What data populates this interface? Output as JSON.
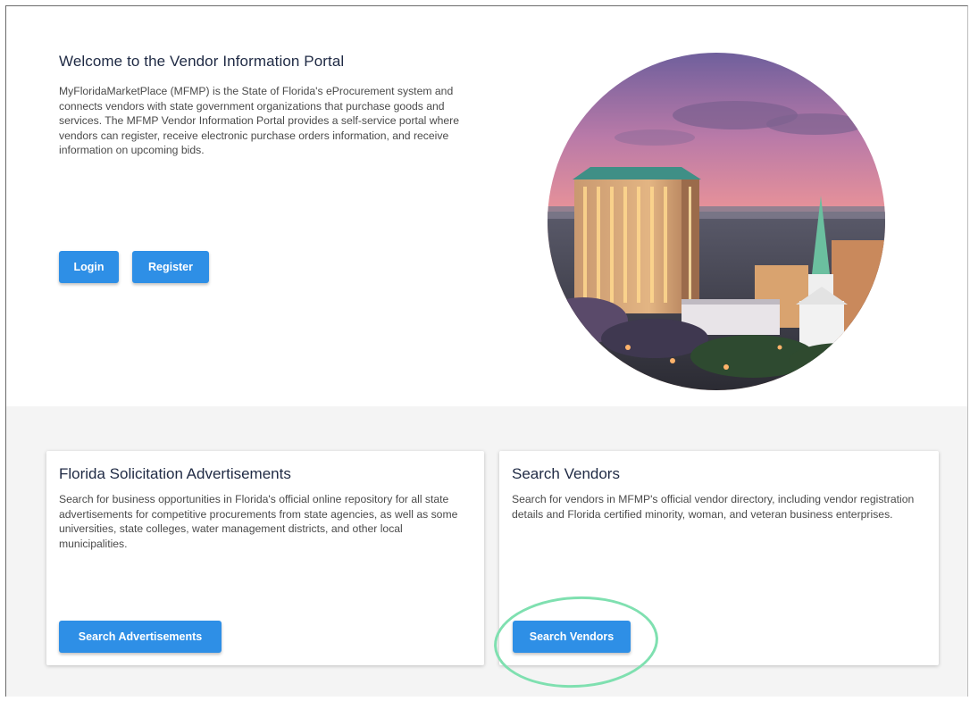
{
  "hero": {
    "title": "Welcome to the Vendor Information Portal",
    "description": "MyFloridaMarketPlace (MFMP) is the State of Florida's eProcurement system and connects vendors with state government organizations that purchase goods and services. The MFMP Vendor Information Portal provides a self-service portal where vendors can register, receive electronic purchase orders information, and receive information on upcoming bids.",
    "login_label": "Login",
    "register_label": "Register",
    "image_icon": "city-skyline-photo"
  },
  "cards": {
    "advertisements": {
      "title": "Florida Solicitation Advertisements",
      "description": "Search for business opportunities in Florida's official online repository for all state advertisements for competitive procurements from state agencies, as well as some universities, state colleges, water management districts, and other local municipalities.",
      "button_label": "Search Advertisements"
    },
    "vendors": {
      "title": "Search Vendors",
      "description": "Search for vendors in MFMP's official vendor directory, including vendor registration details and Florida certified minority, woman, and veteran business enterprises.",
      "button_label": "Search Vendors"
    }
  },
  "colors": {
    "primary_button": "#2e8fe6",
    "highlight_ring": "#7fe0b0",
    "lower_background": "#f4f4f4"
  }
}
